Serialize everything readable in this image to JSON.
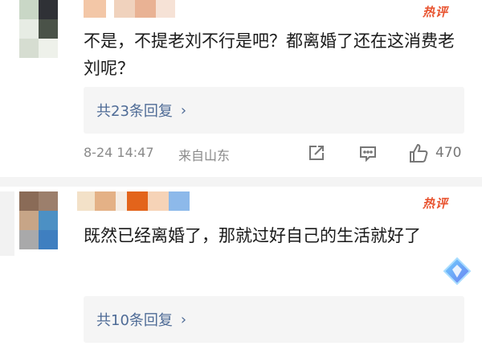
{
  "comments": [
    {
      "badge": "热评",
      "text": "不是，不提老刘不行是吧？都离婚了还在这消费老刘呢？",
      "replies": "共23条回复",
      "time": "8-24 14:47",
      "location": "来自山东",
      "likes": "470"
    },
    {
      "badge": "热评",
      "text": "既然已经离婚了，那就过好自己的生活就好了",
      "replies": "共10条回复"
    }
  ],
  "icons": {
    "share": "share-icon",
    "comment": "comment-icon",
    "like": "thumbs-up-icon",
    "chevron": "chevron-right-icon",
    "gem": "diamond-badge-icon"
  },
  "colors": {
    "hot": "#e8532f",
    "link": "#4e6b96",
    "meta": "#8a8a8a"
  },
  "ui": {
    "chevron_glyph": "›"
  }
}
